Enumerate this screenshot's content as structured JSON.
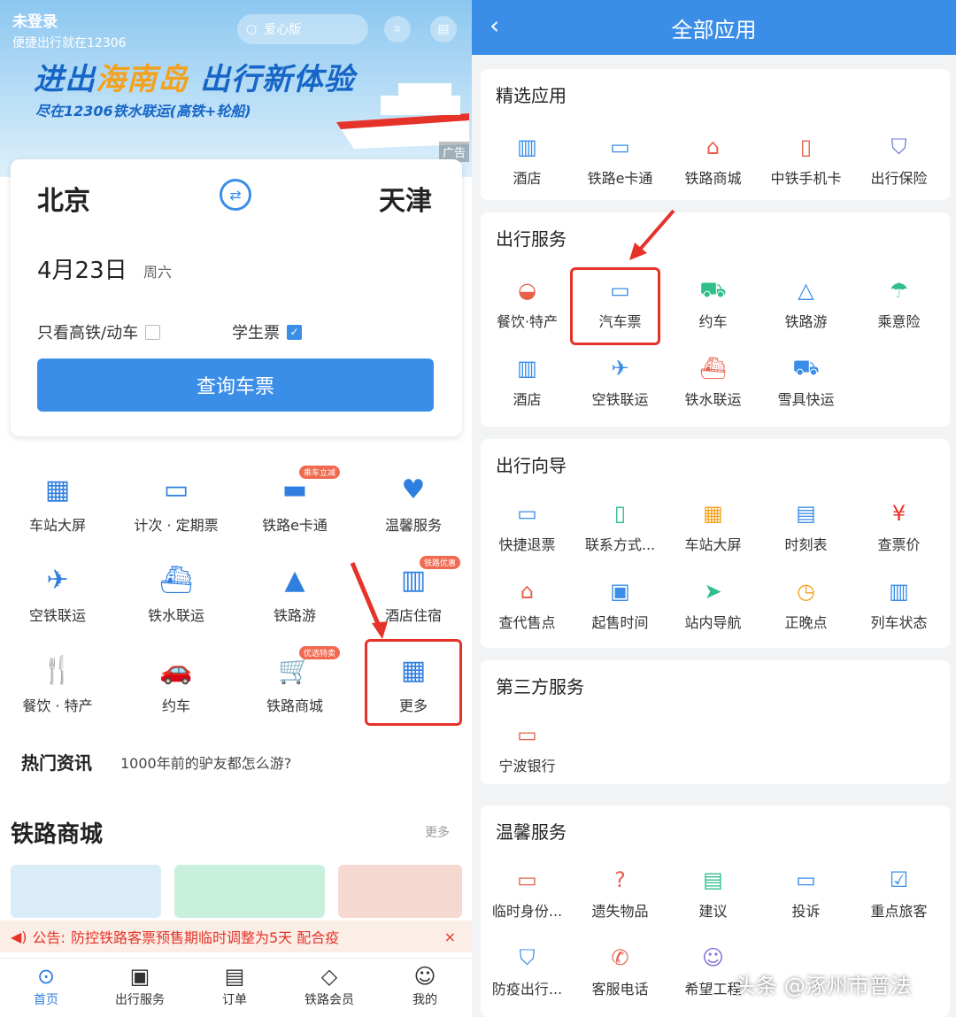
{
  "left": {
    "status": {
      "login": "未登录",
      "slogan": "便捷出行就在12306"
    },
    "search": {
      "placeholder": "爱心版"
    },
    "banner": {
      "title_a": "进出",
      "title_b": "海南岛",
      "title_c": " 出行新体验",
      "subtitle": "尽在12306铁水联运(高铁+轮船)",
      "ad": "广告"
    },
    "query": {
      "from": "北京",
      "to": "天津",
      "date": "4月23日",
      "weekday": "周六",
      "opt_highspeed": "只看高铁/动车",
      "opt_student": "学生票",
      "submit": "查询车票"
    },
    "grid": [
      {
        "label": "车站大屏"
      },
      {
        "label": "计次 · 定期票"
      },
      {
        "label": "铁路e卡通",
        "badge": "乘车立减"
      },
      {
        "label": "温馨服务"
      },
      {
        "label": "空铁联运"
      },
      {
        "label": "铁水联运"
      },
      {
        "label": "铁路游"
      },
      {
        "label": "酒店住宿",
        "badge": "铁路优惠"
      },
      {
        "label": "餐饮 · 特产"
      },
      {
        "label": "约车"
      },
      {
        "label": "铁路商城",
        "badge": "优选特卖"
      },
      {
        "label": "更多"
      }
    ],
    "news": {
      "heading": "热门资讯",
      "text": "1000年前的驴友都怎么游?"
    },
    "shop": {
      "title": "铁路商城",
      "more": "更多"
    },
    "notice": {
      "label": "公告:",
      "text": "防控铁路客票预售期临时调整为5天  配合疫"
    },
    "tabs": [
      {
        "label": "首页"
      },
      {
        "label": "出行服务"
      },
      {
        "label": "订单"
      },
      {
        "label": "铁路会员"
      },
      {
        "label": "我的"
      }
    ]
  },
  "right": {
    "title": "全部应用",
    "sections": [
      {
        "title": "精选应用",
        "items": [
          "酒店",
          "铁路e卡通",
          "铁路商城",
          "中铁手机卡",
          "出行保险"
        ]
      },
      {
        "title": "出行服务",
        "items": [
          "餐饮·特产",
          "汽车票",
          "约车",
          "铁路游",
          "乘意险",
          "酒店",
          "空铁联运",
          "铁水联运",
          "雪具快运"
        ]
      },
      {
        "title": "出行向导",
        "items": [
          "快捷退票",
          "联系方式...",
          "车站大屏",
          "时刻表",
          "查票价",
          "查代售点",
          "起售时间",
          "站内导航",
          "正晚点",
          "列车状态"
        ]
      },
      {
        "title": "第三方服务",
        "items": [
          "宁波银行"
        ]
      },
      {
        "title": "温馨服务",
        "items": [
          "临时身份...",
          "遗失物品",
          "建议",
          "投诉",
          "重点旅客",
          "防疫出行...",
          "客服电话",
          "希望工程"
        ]
      }
    ],
    "watermark": "头条 @涿州市普法"
  },
  "colors": {
    "primary": "#3b8ee8",
    "highlight": "#e5332a"
  }
}
